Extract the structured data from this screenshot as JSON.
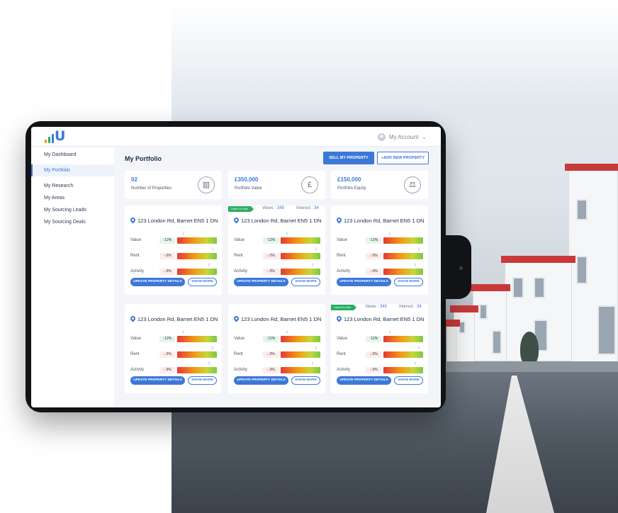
{
  "colors": {
    "accent": "#3c78d8",
    "success": "#27ae60",
    "danger": "#e74c3c",
    "logo_bars": [
      "#f39c12",
      "#27ae60",
      "#3c78d8"
    ]
  },
  "header": {
    "logo_letter": "U",
    "account_label": "My Account",
    "account_icon": "user-avatar-icon",
    "dropdown_icon": "chevron-down-icon"
  },
  "sidebar": {
    "items": [
      {
        "label": "My Dashboard",
        "active": false
      },
      {
        "label": "My Portfolio",
        "active": true
      },
      {
        "label": "My Research",
        "active": false
      },
      {
        "label": "My Areas",
        "active": false
      },
      {
        "label": "My Sourcing Leads",
        "active": false
      },
      {
        "label": "My Sourcing Deals",
        "active": false
      }
    ]
  },
  "main": {
    "title": "My Portfolio",
    "sell_button": "SELL MY PROPERTY",
    "add_button": "+ADD NEW PROPERTY",
    "stats": [
      {
        "value": "02",
        "label": "Number of Properties",
        "icon": "building-icon"
      },
      {
        "value": "£350,000",
        "label": "Portfolio Value",
        "icon": "money-icon"
      },
      {
        "value": "£150,000",
        "label": "Portfolio Equity",
        "icon": "scale-icon"
      }
    ],
    "cards": [
      {
        "ribbon": "",
        "views_label": "",
        "views": "",
        "interest_label": "",
        "interest": "",
        "address": "123 London Rd, Barnet EN5 1 DN",
        "metrics": [
          {
            "label": "Value",
            "change": "12%",
            "dir": "up",
            "level": 0.12
          },
          {
            "label": "Rent",
            "change": "-2%",
            "dir": "down",
            "level": 0.94
          },
          {
            "label": "Activity",
            "change": "-3%",
            "dir": "down",
            "level": 0.84
          }
        ],
        "update_label": "UPDATE PROPERTY DETAILS",
        "more_label": "SHOW MORE"
      },
      {
        "ribbon": "Listed For Sale",
        "views_label": "Views :",
        "views": "345",
        "interest_label": "Interest :",
        "interest": "34",
        "address": "123 London Rd, Barnet EN5 1 DN",
        "metrics": [
          {
            "label": "Value",
            "change": "12%",
            "dir": "up",
            "level": 0.12
          },
          {
            "label": "Rent",
            "change": "-2%",
            "dir": "down",
            "level": 0.94
          },
          {
            "label": "Activity",
            "change": "-3%",
            "dir": "down",
            "level": 0.84
          }
        ],
        "update_label": "UPDATE PROPERTY DETAILS",
        "more_label": "SHOW MORE"
      },
      {
        "ribbon": "",
        "views_label": "",
        "views": "",
        "interest_label": "",
        "interest": "",
        "address": "123 London Rd, Barnet EN5 1 DN",
        "metrics": [
          {
            "label": "Value",
            "change": "12%",
            "dir": "up",
            "level": 0.12
          },
          {
            "label": "Rent",
            "change": "-2%",
            "dir": "down",
            "level": 0.94
          },
          {
            "label": "Activity",
            "change": "-3%",
            "dir": "down",
            "level": 0.84
          }
        ],
        "update_label": "UPDATE PROPERTY DETAILS",
        "more_label": "SHOW MORE"
      },
      {
        "ribbon": "",
        "views_label": "",
        "views": "",
        "interest_label": "",
        "interest": "",
        "address": "123 London Rd, Barnet EN5 1 DN",
        "metrics": [
          {
            "label": "Value",
            "change": "12%",
            "dir": "up",
            "level": 0.12
          },
          {
            "label": "Rent",
            "change": "-2%",
            "dir": "down",
            "level": 0.94
          },
          {
            "label": "Activity",
            "change": "-3%",
            "dir": "down",
            "level": 0.84
          }
        ],
        "update_label": "UPDATE PROPERTY DETAILS",
        "more_label": "SHOW MORE"
      },
      {
        "ribbon": "",
        "views_label": "",
        "views": "",
        "interest_label": "",
        "interest": "",
        "address": "123 London Rd, Barnet EN5 1 DN",
        "metrics": [
          {
            "label": "Value",
            "change": "12%",
            "dir": "up",
            "level": 0.12
          },
          {
            "label": "Rent",
            "change": "-2%",
            "dir": "down",
            "level": 0.94
          },
          {
            "label": "Activity",
            "change": "-3%",
            "dir": "down",
            "level": 0.84
          }
        ],
        "update_label": "UPDATE PROPERTY DETAILS",
        "more_label": "SHOW MORE"
      },
      {
        "ribbon": "Listed For Sale",
        "views_label": "Views :",
        "views": "345",
        "interest_label": "Interest :",
        "interest": "34",
        "address": "123 London Rd, Barnet EN5 1 DN",
        "metrics": [
          {
            "label": "Value",
            "change": "12%",
            "dir": "up",
            "level": 0.12
          },
          {
            "label": "Rent",
            "change": "-2%",
            "dir": "down",
            "level": 0.94
          },
          {
            "label": "Activity",
            "change": "-3%",
            "dir": "down",
            "level": 0.84
          }
        ],
        "update_label": "UPDATE PROPERTY DETAILS",
        "more_label": "SHOW MORE"
      }
    ]
  }
}
